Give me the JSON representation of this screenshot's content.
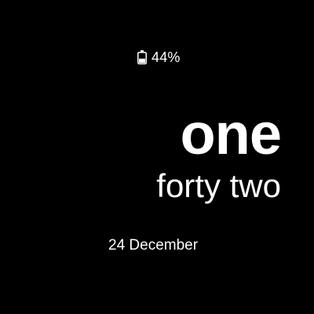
{
  "battery": {
    "icon": "battery-icon",
    "level_percent": 44,
    "label": "44%"
  },
  "time": {
    "hour_words": "one",
    "minute_words": "forty two"
  },
  "date": {
    "label": "24 December"
  },
  "colors": {
    "background": "#000000",
    "foreground": "#ffffff"
  }
}
